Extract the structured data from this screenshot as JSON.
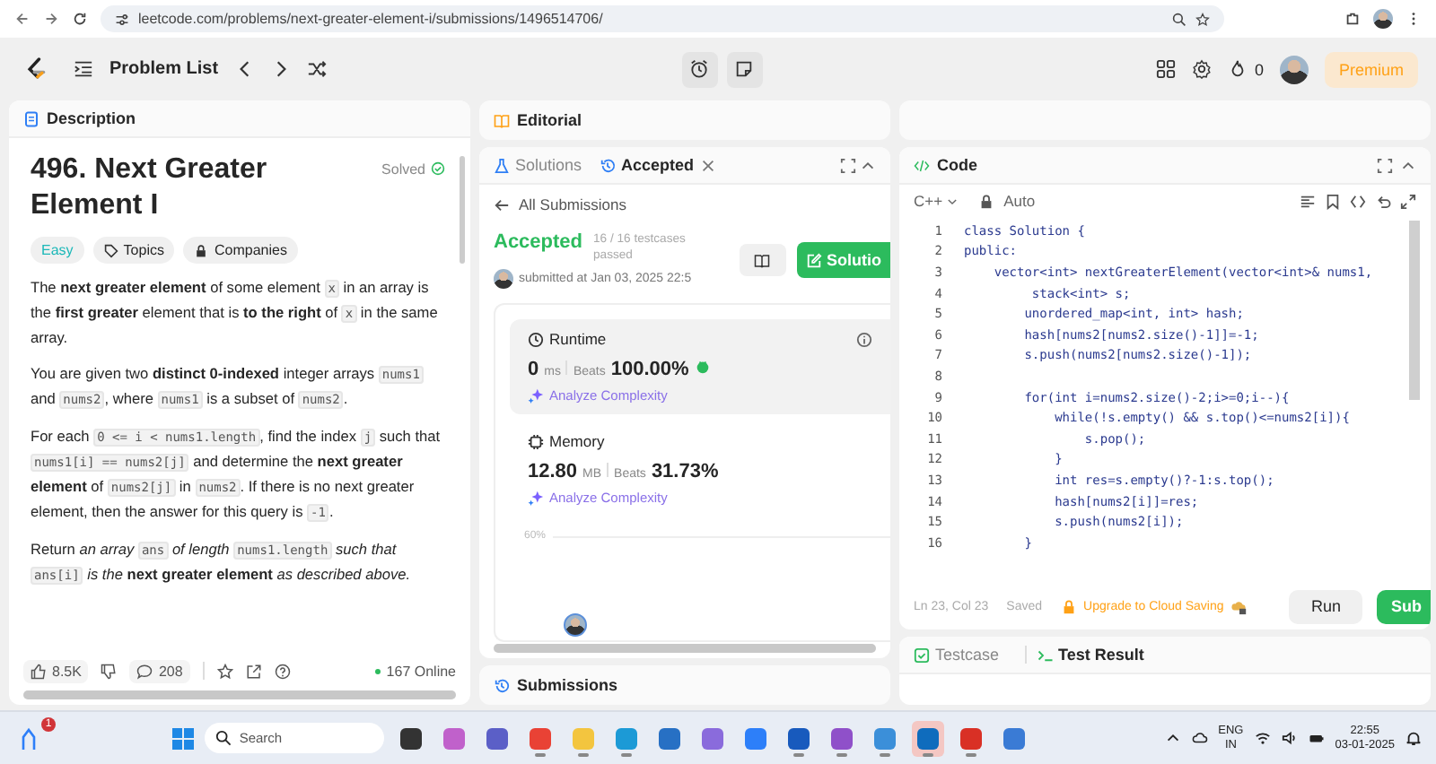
{
  "browser": {
    "url": "leetcode.com/problems/next-greater-element-i/submissions/1496514706/"
  },
  "topbar": {
    "problem_list": "Problem List",
    "streak": "0",
    "premium": "Premium"
  },
  "description": {
    "tab": "Description",
    "title": "496. Next Greater Element I",
    "status": "Solved",
    "tags": [
      {
        "label": "Easy",
        "kind": "difficulty"
      },
      {
        "label": "Topics",
        "kind": "topics"
      },
      {
        "label": "Companies",
        "kind": "companies"
      }
    ],
    "paragraphs": [
      [
        {
          "kind": "text",
          "text": "The **next greater element** of some element "
        },
        {
          "kind": "code",
          "text": "x"
        },
        {
          "kind": "text",
          "text": " in an array is the **first greater** element that is **to the right** of "
        },
        {
          "kind": "code",
          "text": "x"
        },
        {
          "kind": "text",
          "text": " in the same array."
        }
      ],
      [
        {
          "kind": "text",
          "text": "You are given two **distinct 0-indexed** integer arrays "
        },
        {
          "kind": "code",
          "text": "nums1"
        },
        {
          "kind": "text",
          "text": " and "
        },
        {
          "kind": "code",
          "text": "nums2"
        },
        {
          "kind": "text",
          "text": ", where "
        },
        {
          "kind": "code",
          "text": "nums1"
        },
        {
          "kind": "text",
          "text": " is a subset of "
        },
        {
          "kind": "code",
          "text": "nums2"
        },
        {
          "kind": "text",
          "text": "."
        }
      ],
      [
        {
          "kind": "text",
          "text": "For each "
        },
        {
          "kind": "code",
          "text": "0 <= i < nums1.length"
        },
        {
          "kind": "text",
          "text": ", find the index "
        },
        {
          "kind": "code",
          "text": "j"
        },
        {
          "kind": "text",
          "text": " such that "
        },
        {
          "kind": "code",
          "text": "nums1[i] == nums2[j]"
        },
        {
          "kind": "text",
          "text": " and determine the **next greater element** of "
        },
        {
          "kind": "code",
          "text": "nums2[j]"
        },
        {
          "kind": "text",
          "text": " in "
        },
        {
          "kind": "code",
          "text": "nums2"
        },
        {
          "kind": "text",
          "text": ". If there is no next greater element, then the answer for this query is "
        },
        {
          "kind": "code",
          "text": "-1"
        },
        {
          "kind": "text",
          "text": "."
        }
      ],
      [
        {
          "kind": "text",
          "text": "Return *an array* "
        },
        {
          "kind": "code",
          "text": "ans"
        },
        {
          "kind": "text",
          "text": " *of length* "
        },
        {
          "kind": "code",
          "text": "nums1.length"
        },
        {
          "kind": "text",
          "text": " *such that* "
        },
        {
          "kind": "code",
          "text": "ans[i]"
        },
        {
          "kind": "text",
          "text": " *is the* **next greater element** *as described above.*"
        }
      ]
    ],
    "footer": {
      "likes": "8.5K",
      "comments": "208",
      "online": "167 Online"
    }
  },
  "editorial": {
    "tab": "Editorial"
  },
  "submission": {
    "tabs": [
      {
        "label": "Solutions",
        "kind": "solutions",
        "selected": false
      },
      {
        "label": "Accepted",
        "kind": "accepted",
        "selected": true
      }
    ],
    "back": "All Submissions",
    "status": "Accepted",
    "testcases": "16 / 16 testcases passed",
    "submitted": "submitted at Jan 03, 2025 22:5",
    "solution_button": "Solutio",
    "metrics": [
      {
        "kind": "runtime",
        "label": "Runtime",
        "value": "0",
        "unit": "ms",
        "beats_label": "Beats",
        "beats": "100.00%",
        "analyze": "Analyze Complexity",
        "selected": true
      },
      {
        "kind": "memory",
        "label": "Memory",
        "value": "12.80",
        "unit": "MB",
        "beats_label": "Beats",
        "beats": "31.73%",
        "analyze": "Analyze Complexity",
        "selected": false
      }
    ],
    "chart_label": "60%"
  },
  "submissions_panel": {
    "tab": "Submissions"
  },
  "code": {
    "tab": "Code",
    "language": "C++",
    "mode": "Auto",
    "lines": [
      {
        "n": "1",
        "text": "class Solution {"
      },
      {
        "n": "2",
        "text": "public:"
      },
      {
        "n": "3",
        "text": "    vector<int> nextGreaterElement(vector<int>& nums1,"
      },
      {
        "n": "4",
        "text": "         stack<int> s;"
      },
      {
        "n": "5",
        "text": "        unordered_map<int, int> hash;"
      },
      {
        "n": "6",
        "text": "        hash[nums2[nums2.size()-1]]=-1;"
      },
      {
        "n": "7",
        "text": "        s.push(nums2[nums2.size()-1]);"
      },
      {
        "n": "8"
      },
      {
        "n": "9",
        "text": "        for(int i=nums2.size()-2;i>=0;i--){"
      },
      {
        "n": "10",
        "text": "            while(!s.empty() && s.top()<=nums2[i]){"
      },
      {
        "n": "11",
        "text": "                s.pop();"
      },
      {
        "n": "12",
        "text": "            }"
      },
      {
        "n": "13",
        "text": "            int res=s.empty()?-1:s.top();"
      },
      {
        "n": "14",
        "text": "            hash[nums2[i]]=res;"
      },
      {
        "n": "15",
        "text": "            s.push(nums2[i]);"
      },
      {
        "n": "16",
        "text": "        }"
      }
    ],
    "position": "Ln 23, Col 23",
    "saved": "Saved",
    "upgrade": "Upgrade to Cloud Saving",
    "run": "Run",
    "submit": "Sub"
  },
  "testpanel": {
    "tabs": [
      {
        "label": "Testcase",
        "kind": "testcase",
        "selected": false
      },
      {
        "label": "Test Result",
        "kind": "result",
        "selected": true
      }
    ]
  },
  "taskbar": {
    "notification_count": "1",
    "search_placeholder": "Search",
    "apps": [
      {
        "color": "#333333",
        "running": false,
        "selected": false
      },
      {
        "color": "#c061cb",
        "running": false,
        "selected": false
      },
      {
        "color": "#5b5fc7",
        "running": false,
        "selected": false
      },
      {
        "color": "#e94235",
        "running": true,
        "selected": false
      },
      {
        "color": "#f3c53f",
        "running": true,
        "selected": false
      },
      {
        "color": "#1c9ad6",
        "running": true,
        "selected": false
      },
      {
        "color": "#2770c4",
        "running": false,
        "selected": false
      },
      {
        "color": "#8a6bdc",
        "running": false,
        "selected": false
      },
      {
        "color": "#2d7ff9",
        "running": false,
        "selected": false
      },
      {
        "color": "#185abd",
        "running": true,
        "selected": false
      },
      {
        "color": "#8f50c9",
        "running": true,
        "selected": false
      },
      {
        "color": "#3b8fd9",
        "running": true,
        "selected": false
      },
      {
        "color": "#0f6cbd",
        "running": true,
        "selected": true
      },
      {
        "color": "#d93025",
        "running": true,
        "selected": false
      },
      {
        "color": "#3a7bd5",
        "running": false,
        "selected": false
      }
    ],
    "language": "ENG",
    "region": "IN",
    "time": "22:55",
    "date": "03-01-2025"
  }
}
